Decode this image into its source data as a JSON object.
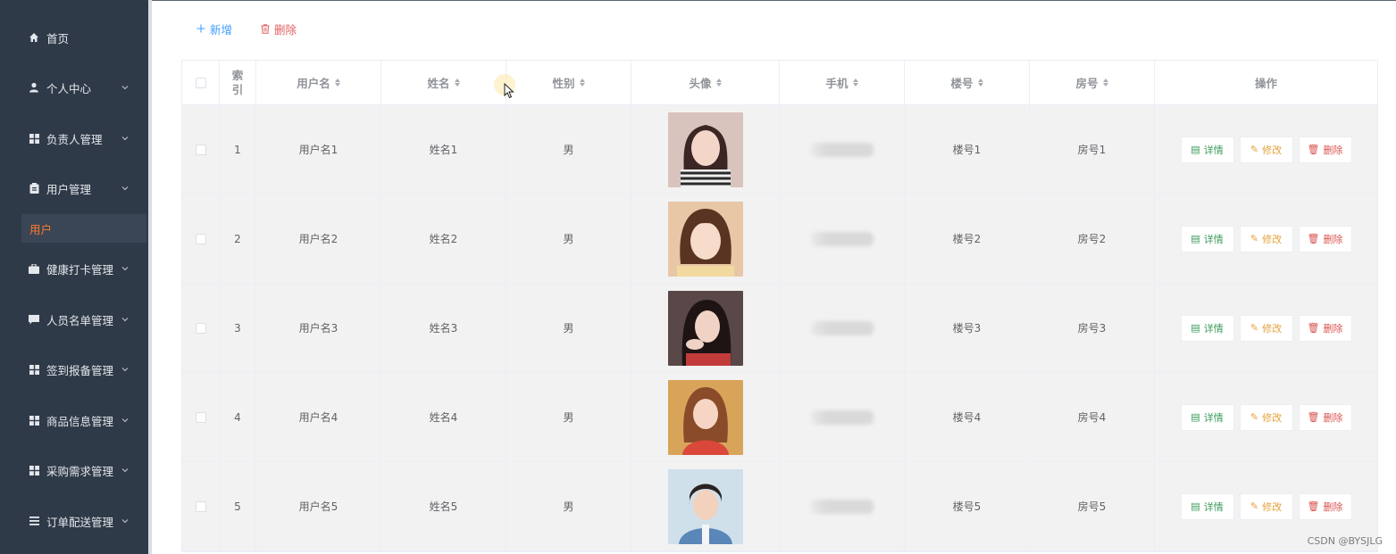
{
  "sidebar": {
    "items": [
      {
        "label": "首页",
        "icon": "home-icon",
        "has_arrow": false
      },
      {
        "label": "个人中心",
        "icon": "user-icon",
        "has_arrow": true
      },
      {
        "label": "负责人管理",
        "icon": "grid-icon",
        "has_arrow": true
      },
      {
        "label": "用户管理",
        "icon": "clipboard-icon",
        "has_arrow": true
      },
      {
        "label": "健康打卡管理",
        "icon": "briefcase-icon",
        "has_arrow": true
      },
      {
        "label": "人员名单管理",
        "icon": "chat-icon",
        "has_arrow": true
      },
      {
        "label": "签到报备管理",
        "icon": "grid-icon",
        "has_arrow": true
      },
      {
        "label": "商品信息管理",
        "icon": "grid-icon",
        "has_arrow": true
      },
      {
        "label": "采购需求管理",
        "icon": "grid-icon",
        "has_arrow": true
      },
      {
        "label": "订单配送管理",
        "icon": "list-icon",
        "has_arrow": true
      }
    ],
    "active_submenu": "用户",
    "colors": {
      "background": "#2f3a48",
      "active_text": "#ff7a2e"
    }
  },
  "toolbar": {
    "add_label": "新增",
    "delete_label": "删除"
  },
  "table": {
    "headers": {
      "index": "索引",
      "username": "用户名",
      "name": "姓名",
      "gender": "性别",
      "avatar": "头像",
      "phone": "手机",
      "building": "楼号",
      "room": "房号",
      "actions": "操作"
    },
    "rows": [
      {
        "index": "1",
        "username": "用户名1",
        "name": "姓名1",
        "gender": "男",
        "building": "楼号1",
        "room": "房号1"
      },
      {
        "index": "2",
        "username": "用户名2",
        "name": "姓名2",
        "gender": "男",
        "building": "楼号2",
        "room": "房号2"
      },
      {
        "index": "3",
        "username": "用户名3",
        "name": "姓名3",
        "gender": "男",
        "building": "楼号3",
        "room": "房号3"
      },
      {
        "index": "4",
        "username": "用户名4",
        "name": "姓名4",
        "gender": "男",
        "building": "楼号4",
        "room": "房号4"
      },
      {
        "index": "5",
        "username": "用户名5",
        "name": "姓名5",
        "gender": "男",
        "building": "楼号5",
        "room": "房号5"
      }
    ],
    "actions": {
      "detail": "详情",
      "edit": "修改",
      "delete": "删除"
    }
  },
  "watermark": "CSDN @BYSJLG"
}
